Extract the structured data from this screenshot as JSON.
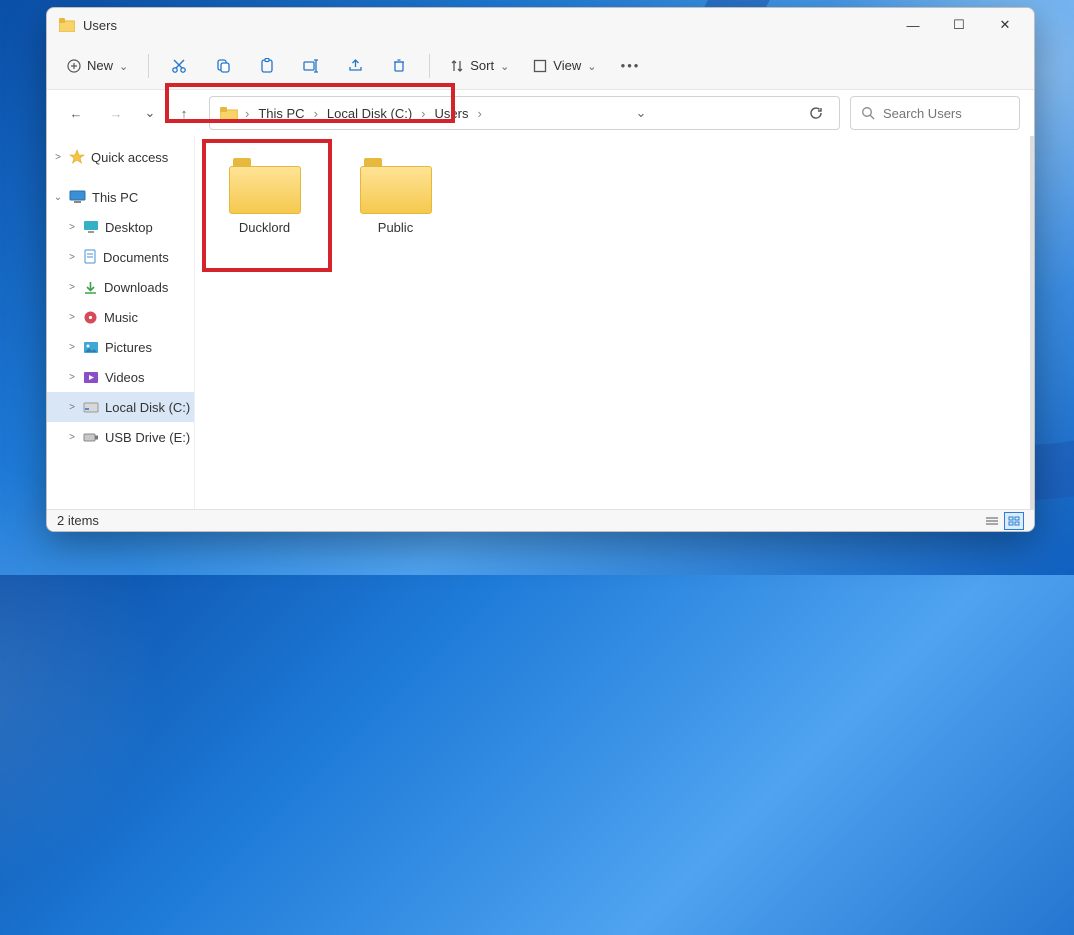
{
  "window": {
    "title": "Users"
  },
  "titlebar_controls": {
    "min": "—",
    "max": "☐",
    "close": "✕"
  },
  "toolbar": {
    "new_label": "New",
    "sort_label": "Sort",
    "view_label": "View"
  },
  "nav": {
    "back": "←",
    "forward": "→",
    "recent": "⌄",
    "up": "↑"
  },
  "breadcrumb": [
    {
      "label": "This PC"
    },
    {
      "label": "Local Disk (C:)"
    },
    {
      "label": "Users"
    }
  ],
  "search": {
    "placeholder": "Search Users"
  },
  "sidebar": [
    {
      "chev": ">",
      "icon": "star",
      "label": "Quick access",
      "indent": 0
    },
    {
      "chev": "⌄",
      "icon": "pc",
      "label": "This PC",
      "indent": 0
    },
    {
      "chev": ">",
      "icon": "desktop",
      "label": "Desktop",
      "indent": 1
    },
    {
      "chev": ">",
      "icon": "doc",
      "label": "Documents",
      "indent": 1
    },
    {
      "chev": ">",
      "icon": "down",
      "label": "Downloads",
      "indent": 1
    },
    {
      "chev": ">",
      "icon": "music",
      "label": "Music",
      "indent": 1
    },
    {
      "chev": ">",
      "icon": "pic",
      "label": "Pictures",
      "indent": 1
    },
    {
      "chev": ">",
      "icon": "vid",
      "label": "Videos",
      "indent": 1
    },
    {
      "chev": ">",
      "icon": "disk",
      "label": "Local Disk (C:)",
      "indent": 1,
      "selected": true
    },
    {
      "chev": ">",
      "icon": "usb",
      "label": "USB Drive (E:)",
      "indent": 1
    }
  ],
  "items": [
    {
      "name": "Ducklord"
    },
    {
      "name": "Public"
    }
  ],
  "status": {
    "count": "2 items"
  }
}
